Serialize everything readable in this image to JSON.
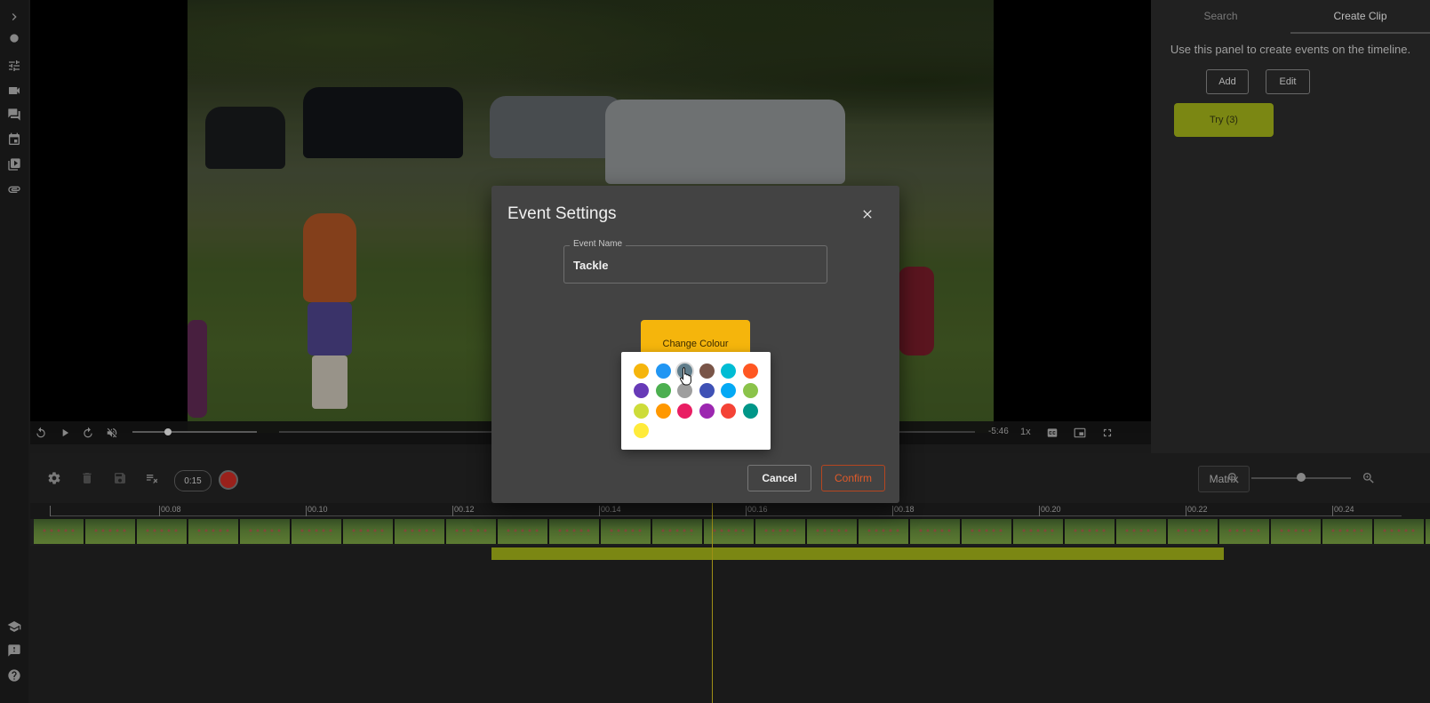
{
  "right_panel": {
    "tabs": [
      {
        "label": "Search"
      },
      {
        "label": "Create Clip"
      }
    ],
    "info": "Use this panel to create events on the timeline.",
    "add_label": "Add",
    "edit_label": "Edit",
    "event_button": {
      "label": "Try (3)",
      "color": "#8d9a16"
    }
  },
  "video_controls": {
    "remaining_time": "-5:46",
    "speed": "1x",
    "progress": 0.08
  },
  "timeline": {
    "time_chip": "0:15",
    "matrix_label": "Matrix",
    "ruler_labels": [
      "00.08",
      "00.10",
      "00.12",
      "00.14",
      "00.16",
      "00.18",
      "00.20",
      "00.22",
      "00.24"
    ],
    "zoom_level": 0.5,
    "event_color": "#8d9a16"
  },
  "modal": {
    "title": "Event Settings",
    "event_name_label": "Event Name",
    "event_name_value": "Tackle",
    "change_colour_label": "Change Colour",
    "current_color": "#f5b50c",
    "cancel_label": "Cancel",
    "confirm_label": "Confirm"
  },
  "palette": {
    "colors": [
      "#f5b50c",
      "#2196f3",
      "#607d8b",
      "#795548",
      "#00bcd4",
      "#ff5722",
      "#673ab7",
      "#4caf50",
      "#9e9e9e",
      "#3f51b5",
      "#03a9f4",
      "#8bc34a",
      "#cddc39",
      "#ff9800",
      "#e91e63",
      "#9c27b0",
      "#f44336",
      "#009688",
      "#ffeb3b"
    ],
    "hovered_index": 2
  },
  "icons": {
    "left_bar": [
      "chevron-right-icon",
      "record-dot-icon",
      "sliders-icon",
      "video-camera-icon",
      "comments-icon",
      "calendar-icon",
      "video-library-icon",
      "attachment-icon"
    ],
    "left_bar_bottom": [
      "school-icon",
      "feedback-icon",
      "help-icon"
    ]
  }
}
